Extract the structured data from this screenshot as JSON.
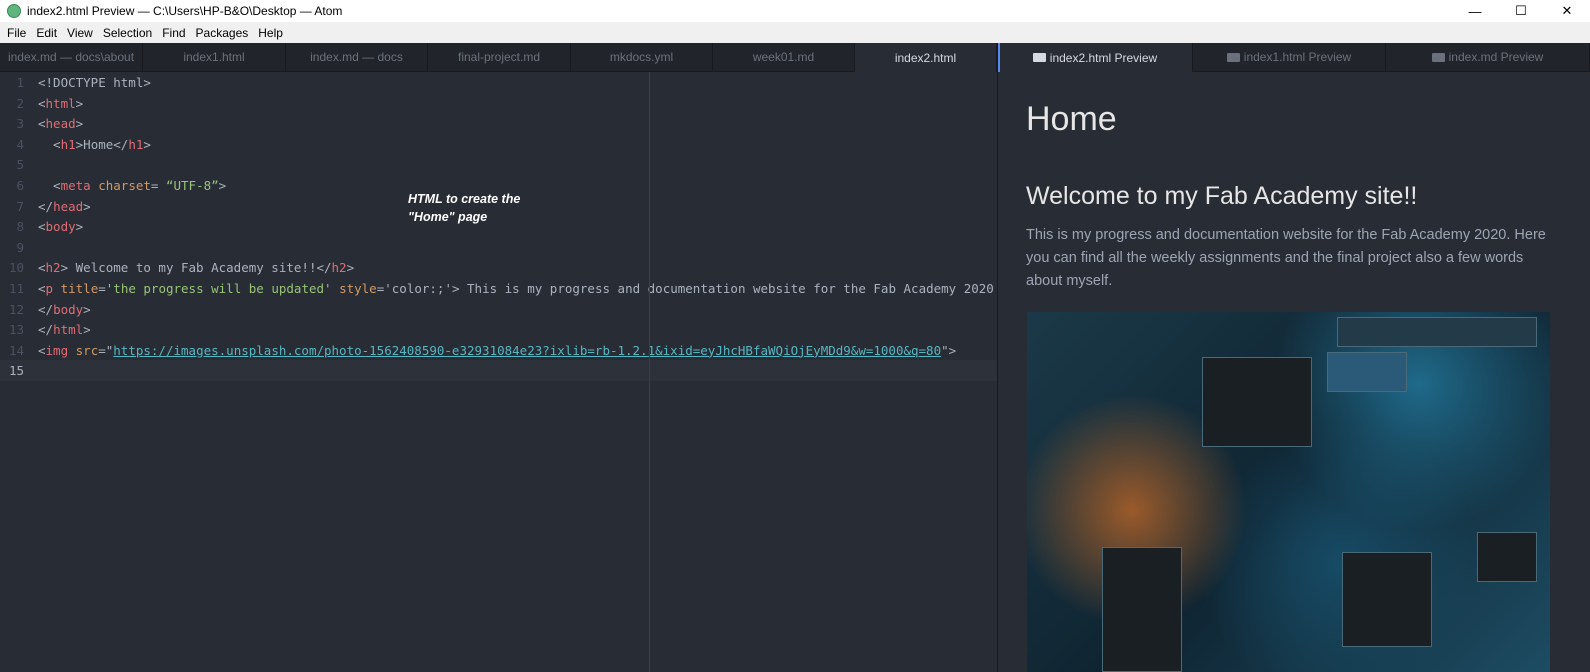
{
  "window": {
    "title": "index2.html Preview — C:\\Users\\HP-B&O\\Desktop — Atom",
    "controls": [
      "—",
      "☐",
      "✕"
    ]
  },
  "menu": [
    "File",
    "Edit",
    "View",
    "Selection",
    "Find",
    "Packages",
    "Help"
  ],
  "left_tabs": [
    "index.md — docs\\about",
    "index1.html",
    "index.md — docs",
    "final-project.md",
    "mkdocs.yml",
    "week01.md",
    "index2.html"
  ],
  "right_tabs": [
    "index2.html Preview",
    "index1.html Preview",
    "index.md Preview"
  ],
  "editor": {
    "lines": [
      [
        [
          "t-txt",
          "<!DOCTYPE html>"
        ]
      ],
      [
        [
          "t-txt",
          "<"
        ],
        [
          "t-tag",
          "html"
        ],
        [
          "t-txt",
          ">"
        ]
      ],
      [
        [
          "t-txt",
          "<"
        ],
        [
          "t-tag",
          "head"
        ],
        [
          "t-txt",
          ">"
        ]
      ],
      [
        [
          "t-txt",
          "  <"
        ],
        [
          "t-tag",
          "h1"
        ],
        [
          "t-txt",
          ">Home</"
        ],
        [
          "t-tag",
          "h1"
        ],
        [
          "t-txt",
          ">"
        ]
      ],
      [],
      [
        [
          "t-txt",
          "  <"
        ],
        [
          "t-tag",
          "meta"
        ],
        [
          "t-txt",
          " "
        ],
        [
          "t-attr",
          "charset"
        ],
        [
          "t-txt",
          "= "
        ],
        [
          "t-str",
          "“UTF-8”"
        ],
        [
          "t-txt",
          ">"
        ]
      ],
      [
        [
          "t-txt",
          "</"
        ],
        [
          "t-tag",
          "head"
        ],
        [
          "t-txt",
          ">"
        ]
      ],
      [
        [
          "t-txt",
          "<"
        ],
        [
          "t-tag",
          "body"
        ],
        [
          "t-txt",
          ">"
        ]
      ],
      [],
      [
        [
          "t-txt",
          "<"
        ],
        [
          "t-tag",
          "h2"
        ],
        [
          "t-txt",
          "> Welcome to my Fab Academy site!!</"
        ],
        [
          "t-tag",
          "h2"
        ],
        [
          "t-txt",
          ">"
        ]
      ],
      [
        [
          "t-txt",
          "<"
        ],
        [
          "t-tag",
          "p"
        ],
        [
          "t-txt",
          " "
        ],
        [
          "t-attr",
          "title"
        ],
        [
          "t-txt",
          "='"
        ],
        [
          "t-str",
          "the progress will be updated"
        ],
        [
          "t-txt",
          "' "
        ],
        [
          "t-attr",
          "style"
        ],
        [
          "t-txt",
          "='color:;'> This is my progress and documentation website for the Fab Academy 2020"
        ]
      ],
      [
        [
          "t-txt",
          "</"
        ],
        [
          "t-tag",
          "body"
        ],
        [
          "t-txt",
          ">"
        ]
      ],
      [
        [
          "t-txt",
          "</"
        ],
        [
          "t-tag",
          "html"
        ],
        [
          "t-txt",
          ">"
        ]
      ],
      [
        [
          "t-txt",
          "<"
        ],
        [
          "t-tag",
          "img"
        ],
        [
          "t-txt",
          " "
        ],
        [
          "t-attr",
          "src"
        ],
        [
          "t-txt",
          "=\""
        ],
        [
          "t-url",
          "https://images.unsplash.com/photo-1562408590-e32931084e23?ixlib=rb-1.2.1&ixid=eyJhcHBfaWQiOjEyMDd9&w=1000&q=80"
        ],
        [
          "t-txt",
          "\">"
        ]
      ],
      []
    ],
    "cursor_line": 15,
    "annotation": [
      "HTML to create the",
      "\"Home\" page"
    ]
  },
  "preview": {
    "h1": "Home",
    "h2": "Welcome to my Fab Academy site!!",
    "p": "This is my progress and documentation website for the Fab Academy 2020. Here you can find all the weekly assignments and the final project also a few words about myself."
  }
}
